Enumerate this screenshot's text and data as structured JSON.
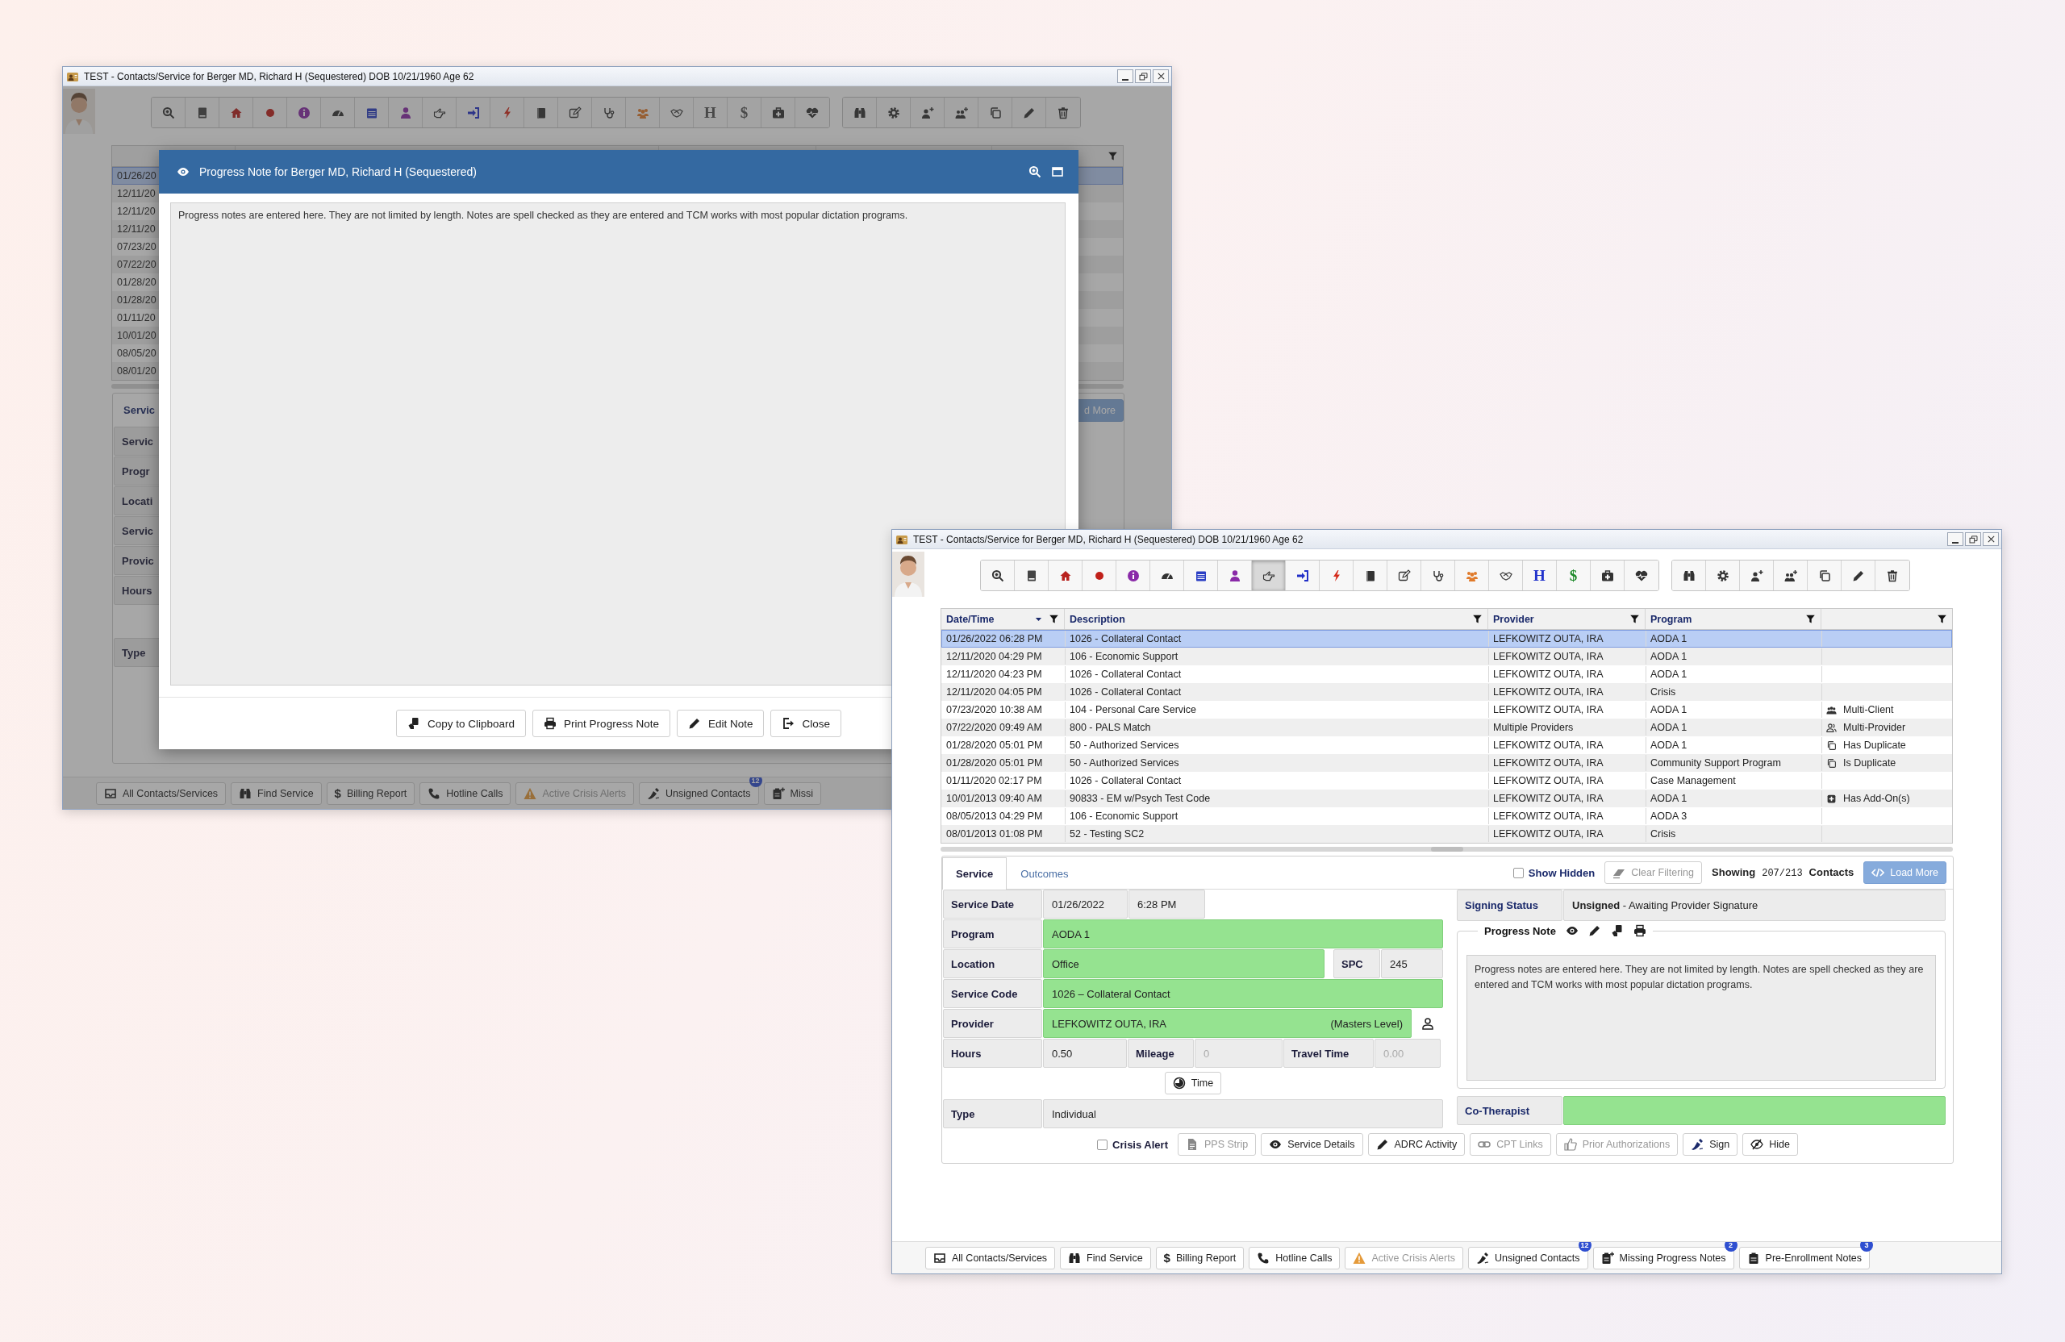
{
  "back_window": {
    "title": "TEST - Contacts/Service for Berger MD, Richard H (Sequestered) DOB 10/21/1960 Age 62",
    "toolbar": {
      "groups": [
        {
          "buttons": [
            {
              "kind": "zoom",
              "selected": false
            },
            {
              "kind": "book",
              "selected": false
            },
            {
              "kind": "home",
              "selected": false
            },
            {
              "kind": "record",
              "selected": false
            },
            {
              "kind": "info",
              "selected": false
            },
            {
              "kind": "gauge",
              "selected": false
            },
            {
              "kind": "calendar",
              "selected": false
            },
            {
              "kind": "person",
              "selected": false
            },
            {
              "kind": "hand",
              "selected": false
            },
            {
              "kind": "signin",
              "selected": false
            },
            {
              "kind": "bolt",
              "selected": false
            },
            {
              "kind": "notebook",
              "selected": false
            },
            {
              "kind": "edit",
              "selected": false
            },
            {
              "kind": "stethoscope",
              "selected": false
            },
            {
              "kind": "group",
              "selected": false
            },
            {
              "kind": "handshake",
              "selected": false
            },
            {
              "kind": "glyph",
              "glyph": "H",
              "selected": false
            },
            {
              "kind": "glyph",
              "glyph": "$",
              "selected": false
            },
            {
              "kind": "medkit",
              "selected": false
            },
            {
              "kind": "heartbeat",
              "selected": false
            }
          ]
        },
        {
          "buttons": [
            {
              "kind": "binoculars",
              "selected": false
            },
            {
              "kind": "gear",
              "selected": false
            },
            {
              "kind": "personplus",
              "selected": false
            },
            {
              "kind": "groupplus",
              "selected": false
            },
            {
              "kind": "copy",
              "selected": false
            },
            {
              "kind": "pencil",
              "selected": false
            },
            {
              "kind": "trash",
              "selected": false
            }
          ]
        }
      ]
    },
    "table": {
      "rows": [
        {
          "date_time": "01/26/20",
          "selected": true
        },
        {
          "date_time": "12/11/20",
          "selected": false
        },
        {
          "date_time": "12/11/20",
          "selected": false
        },
        {
          "date_time": "12/11/20",
          "selected": false
        },
        {
          "date_time": "07/23/20",
          "selected": false
        },
        {
          "date_time": "07/22/20",
          "selected": false
        },
        {
          "date_time": "01/28/20",
          "selected": false
        },
        {
          "date_time": "01/28/20",
          "selected": false
        },
        {
          "date_time": "01/11/20",
          "selected": false
        },
        {
          "date_time": "10/01/20",
          "selected": false
        },
        {
          "date_time": "08/05/20",
          "selected": false
        },
        {
          "date_time": "08/01/20",
          "selected": false
        }
      ]
    },
    "form_labels": [
      "Servic",
      "Servic",
      "Progr",
      "Locati",
      "Servic",
      "Provic",
      "Hours",
      "Type"
    ],
    "load_more": {
      "label": "d More"
    },
    "bottom_bar": [
      {
        "label": "All Contacts/Services",
        "kind": "contacts",
        "disabled": false
      },
      {
        "label": "Find Service",
        "kind": "search",
        "disabled": false
      },
      {
        "label": "Billing Report",
        "kind": "glyph",
        "glyph": "$",
        "disabled": false
      },
      {
        "label": "Hotline Calls",
        "kind": "hotline",
        "disabled": false
      },
      {
        "label": "Active Crisis Alerts",
        "kind": "alerts",
        "disabled": true
      },
      {
        "label": "Unsigned Contacts",
        "kind": "unsigned",
        "badge": "12",
        "disabled": false
      },
      {
        "label": "Missi",
        "kind": "missing",
        "disabled": false
      }
    ],
    "dialog": {
      "title": "Progress Note for Berger MD, Richard H (Sequestered)",
      "note": "Progress notes are entered here. They are not limited by length. Notes are spell checked as they are entered and TCM works with most popular dictation programs.",
      "buttons": [
        {
          "label": "Copy to Clipboard",
          "kind": "copy"
        },
        {
          "label": "Print Progress Note",
          "kind": "print"
        },
        {
          "label": "Edit Note",
          "kind": "edit"
        },
        {
          "label": "Close",
          "kind": "exit"
        }
      ]
    }
  },
  "front_window": {
    "title": "TEST - Contacts/Service for Berger MD, Richard H (Sequestered) DOB 10/21/1960 Age 62",
    "toolbar": {
      "groups": [
        {
          "buttons": [
            {
              "kind": "zoom",
              "selected": false
            },
            {
              "kind": "book",
              "selected": false
            },
            {
              "kind": "home",
              "selected": false
            },
            {
              "kind": "record",
              "selected": false
            },
            {
              "kind": "info",
              "selected": false
            },
            {
              "kind": "gauge",
              "selected": false
            },
            {
              "kind": "calendar",
              "selected": false
            },
            {
              "kind": "person",
              "selected": false
            },
            {
              "kind": "hand",
              "selected": true
            },
            {
              "kind": "signin",
              "selected": false
            },
            {
              "kind": "bolt",
              "selected": false
            },
            {
              "kind": "notebook",
              "selected": false
            },
            {
              "kind": "edit",
              "selected": false
            },
            {
              "kind": "stethoscope",
              "selected": false
            },
            {
              "kind": "group",
              "selected": false
            },
            {
              "kind": "handshake",
              "selected": false
            },
            {
              "kind": "glyph",
              "glyph": "H",
              "color": "#2233cc",
              "selected": false
            },
            {
              "kind": "glyph",
              "glyph": "$",
              "color": "#1e8a2a",
              "selected": false
            },
            {
              "kind": "medkit",
              "selected": false
            },
            {
              "kind": "heartbeat",
              "selected": false
            }
          ]
        },
        {
          "buttons": [
            {
              "kind": "binoculars",
              "selected": false
            },
            {
              "kind": "gear",
              "selected": false
            },
            {
              "kind": "personplus",
              "selected": false
            },
            {
              "kind": "groupplus",
              "selected": false
            },
            {
              "kind": "copy",
              "selected": false
            },
            {
              "kind": "pencil",
              "selected": false
            },
            {
              "kind": "trash",
              "selected": false
            }
          ]
        }
      ]
    },
    "table": {
      "columns": [
        {
          "label": "Date/Time",
          "sorted": true
        },
        {
          "label": "Description"
        },
        {
          "label": "Provider"
        },
        {
          "label": "Program"
        },
        {}
      ],
      "rows": [
        {
          "date_time": "01/26/2022 06:28 PM",
          "description": "1026 - Collateral Contact",
          "provider": "LEFKOWITZ OUTA, IRA",
          "program": "AODA 1",
          "selected": true
        },
        {
          "date_time": "12/11/2020 04:29 PM",
          "description": "106 - Economic Support",
          "provider": "LEFKOWITZ OUTA, IRA",
          "program": "AODA 1",
          "selected": false
        },
        {
          "date_time": "12/11/2020 04:23 PM",
          "description": "1026 - Collateral Contact",
          "provider": "LEFKOWITZ OUTA, IRA",
          "program": "AODA 1",
          "selected": false
        },
        {
          "date_time": "12/11/2020 04:05 PM",
          "description": "1026 - Collateral Contact",
          "provider": "LEFKOWITZ OUTA, IRA",
          "program": "Crisis",
          "selected": false
        },
        {
          "date_time": "07/23/2020 10:38 AM",
          "description": "104 - Personal Care Service",
          "provider": "LEFKOWITZ OUTA, IRA",
          "program": "AODA 1",
          "flag": {
            "kind": "multi_client",
            "text": "Multi-Client"
          },
          "selected": false
        },
        {
          "date_time": "07/22/2020 09:49 AM",
          "description": "800 - PALS Match",
          "provider": "Multiple Providers",
          "program": "AODA 1",
          "flag": {
            "kind": "multi_provider",
            "text": "Multi-Provider"
          },
          "selected": false
        },
        {
          "date_time": "01/28/2020 05:01 PM",
          "description": "50 - Authorized Services",
          "provider": "LEFKOWITZ OUTA, IRA",
          "program": "AODA 1",
          "flag": {
            "kind": "duplicate",
            "text": "Has Duplicate"
          },
          "selected": false
        },
        {
          "date_time": "01/28/2020 05:01 PM",
          "description": "50 - Authorized Services",
          "provider": "LEFKOWITZ OUTA, IRA",
          "program": "Community Support Program",
          "flag": {
            "kind": "duplicate",
            "text": "Is Duplicate"
          },
          "selected": false
        },
        {
          "date_time": "01/11/2020 02:17 PM",
          "description": "1026 - Collateral Contact",
          "provider": "LEFKOWITZ OUTA, IRA",
          "program": "Case Management",
          "selected": false
        },
        {
          "date_time": "10/01/2013 09:40 AM",
          "description": "90833 - EM w/Psych Test Code",
          "provider": "LEFKOWITZ OUTA, IRA",
          "program": "AODA 1",
          "flag": {
            "kind": "add_on",
            "text": "Has Add-On(s)"
          },
          "selected": false
        },
        {
          "date_time": "08/05/2013 04:29 PM",
          "description": "106 - Economic Support",
          "provider": "LEFKOWITZ OUTA, IRA",
          "program": "AODA 3",
          "selected": false
        },
        {
          "date_time": "08/01/2013 01:08 PM",
          "description": "52 - Testing SC2",
          "provider": "LEFKOWITZ OUTA, IRA",
          "program": "Crisis",
          "selected": false
        }
      ]
    },
    "tabs": [
      {
        "label": "Service",
        "selected": true
      },
      {
        "label": "Outcomes",
        "selected": false
      }
    ],
    "show_hidden": {
      "label": "Show Hidden",
      "checked": false
    },
    "clear_filtering": {
      "label": "Clear Filtering",
      "disabled": true
    },
    "showing": {
      "label": "Showing",
      "count": "207/213",
      "unit": "Contacts"
    },
    "load_more": {
      "label": "Load More"
    },
    "service_rows": [
      {
        "kind": "date",
        "label": "Service Date",
        "date": "01/26/2022",
        "time": "6:28 PM"
      },
      {
        "kind": "single",
        "label": "Program",
        "value": "AODA 1",
        "highlighted": true
      },
      {
        "kind": "with_code",
        "label": "Location",
        "value": "Office",
        "highlighted": true,
        "code_label": "SPC",
        "code": "245"
      },
      {
        "kind": "single",
        "label": "Service Code",
        "value": "1026 – Collateral Contact",
        "highlighted": true
      },
      {
        "kind": "provider",
        "label": "Provider",
        "value": "LEFKOWITZ OUTA, IRA",
        "credential": "(Masters Level)",
        "highlighted": true
      },
      {
        "kind": "measures",
        "items": [
          {
            "label": "Hours",
            "value": "0.50",
            "disabled": false
          },
          {
            "label": "Mileage",
            "value": "0",
            "disabled": true
          },
          {
            "label": "Travel Time",
            "value": "0.00",
            "disabled": true
          }
        ]
      },
      {
        "kind": "button",
        "label": "Time"
      },
      {
        "kind": "single",
        "label": "Type",
        "value": "Individual",
        "highlighted": false
      }
    ],
    "signing_status": {
      "label": "Signing Status",
      "value": "**Unsigned** - Awaiting Provider Signature"
    },
    "progress_note": {
      "label": "Progress Note",
      "text": "Progress notes are entered here. They are not limited by length. Notes are spell checked as they are entered and TCM works with most popular dictation programs."
    },
    "co_therapist": {
      "label": "Co-Therapist",
      "highlighted": true
    },
    "actions": [
      {
        "kind": "checkbox",
        "label": "Crisis Alert",
        "checked": false
      },
      {
        "kind": "document",
        "label": "PPS Strip",
        "disabled": true
      },
      {
        "kind": "view",
        "label": "Service Details",
        "disabled": false
      },
      {
        "kind": "edit",
        "label": "ADRC Activity",
        "disabled": false
      },
      {
        "kind": "link",
        "label": "CPT Links",
        "disabled": true
      },
      {
        "kind": "authorize",
        "label": "Prior Authorizations",
        "disabled": true
      },
      {
        "kind": "sign",
        "label": "Sign",
        "disabled": false
      },
      {
        "kind": "hide",
        "label": "Hide",
        "disabled": false
      }
    ],
    "bottom_bar": [
      {
        "label": "All Contacts/Services",
        "kind": "contacts",
        "disabled": false
      },
      {
        "label": "Find Service",
        "kind": "search",
        "disabled": false
      },
      {
        "label": "Billing Report",
        "kind": "glyph",
        "glyph": "$",
        "disabled": false
      },
      {
        "label": "Hotline Calls",
        "kind": "hotline",
        "disabled": false
      },
      {
        "label": "Active Crisis Alerts",
        "kind": "alerts",
        "disabled": true
      },
      {
        "label": "Unsigned Contacts",
        "kind": "unsigned",
        "badge": "12",
        "disabled": false
      },
      {
        "label": "Missing Progress Notes",
        "kind": "missing",
        "badge": "2",
        "disabled": false
      },
      {
        "label": "Pre-Enrollment Notes",
        "kind": "enrollment",
        "badge": "3",
        "disabled": false
      }
    ]
  }
}
